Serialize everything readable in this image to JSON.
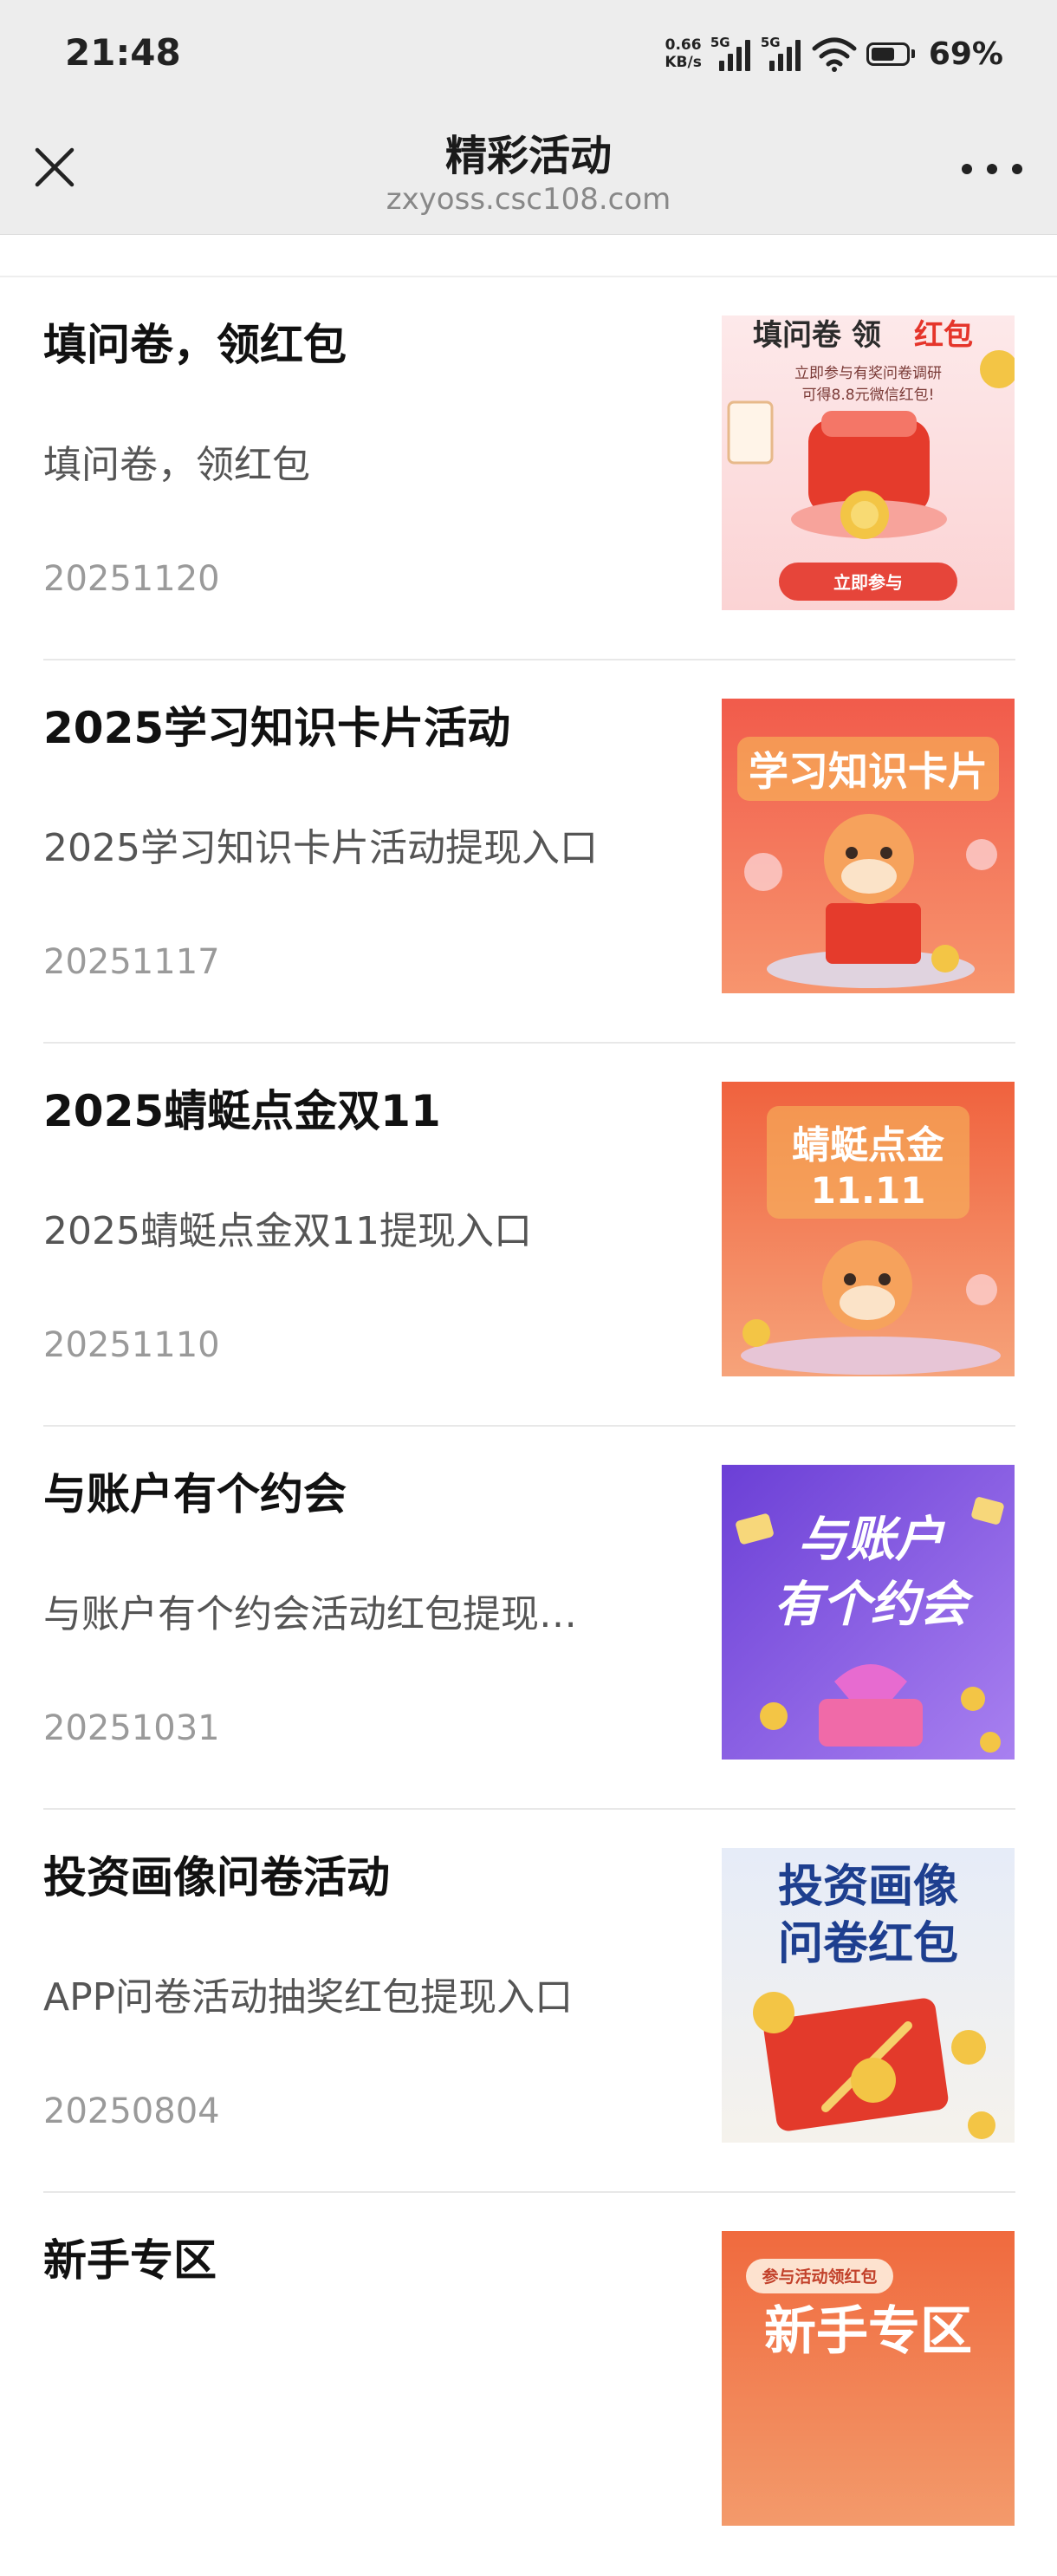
{
  "status_bar": {
    "time": "21:48",
    "net_speed_value": "0.66",
    "net_speed_unit": "KB/s",
    "signal1_label": "5G",
    "signal2_label": "5G",
    "battery_percent": "69%"
  },
  "header": {
    "title": "精彩活动",
    "url": "zxyoss.csc108.com"
  },
  "articles": [
    {
      "title": "填问卷，领红包",
      "desc": "填问卷，领红包",
      "date": "20251120",
      "thumb": {
        "headline_a": "填问卷 领",
        "headline_b": "红包",
        "line1": "立即参与有奖问卷调研",
        "line2": "可得8.8元微信红包!",
        "button": "立即参与"
      }
    },
    {
      "title": "2025学习知识卡片活动",
      "desc": "2025学习知识卡片活动提现入口",
      "date": "20251117",
      "thumb": {
        "headline": "学习知识卡片"
      }
    },
    {
      "title": "2025蜻蜓点金双11",
      "desc": "2025蜻蜓点金双11提现入口",
      "date": "20251110",
      "thumb": {
        "headline": "蜻蜓点金",
        "sub": "11.11"
      }
    },
    {
      "title": "与账户有个约会",
      "desc": "与账户有个约会活动红包提现…",
      "date": "20251031",
      "thumb": {
        "line1": "与账户",
        "line2": "有个约会"
      }
    },
    {
      "title": "投资画像问卷活动",
      "desc": "APP问卷活动抽奖红包提现入口",
      "date": "20250804",
      "thumb": {
        "line1": "投资画像",
        "line2": "问卷红包"
      }
    },
    {
      "title": "新手专区",
      "desc": "",
      "date": "",
      "thumb": {
        "pill": "参与活动领红包",
        "headline": "新手专区"
      }
    }
  ],
  "colors": {
    "header_bg": "#ededed",
    "red_accent": "#e8473a",
    "purple_accent": "#8a4fe0",
    "blue_text": "#1e3f8f"
  }
}
